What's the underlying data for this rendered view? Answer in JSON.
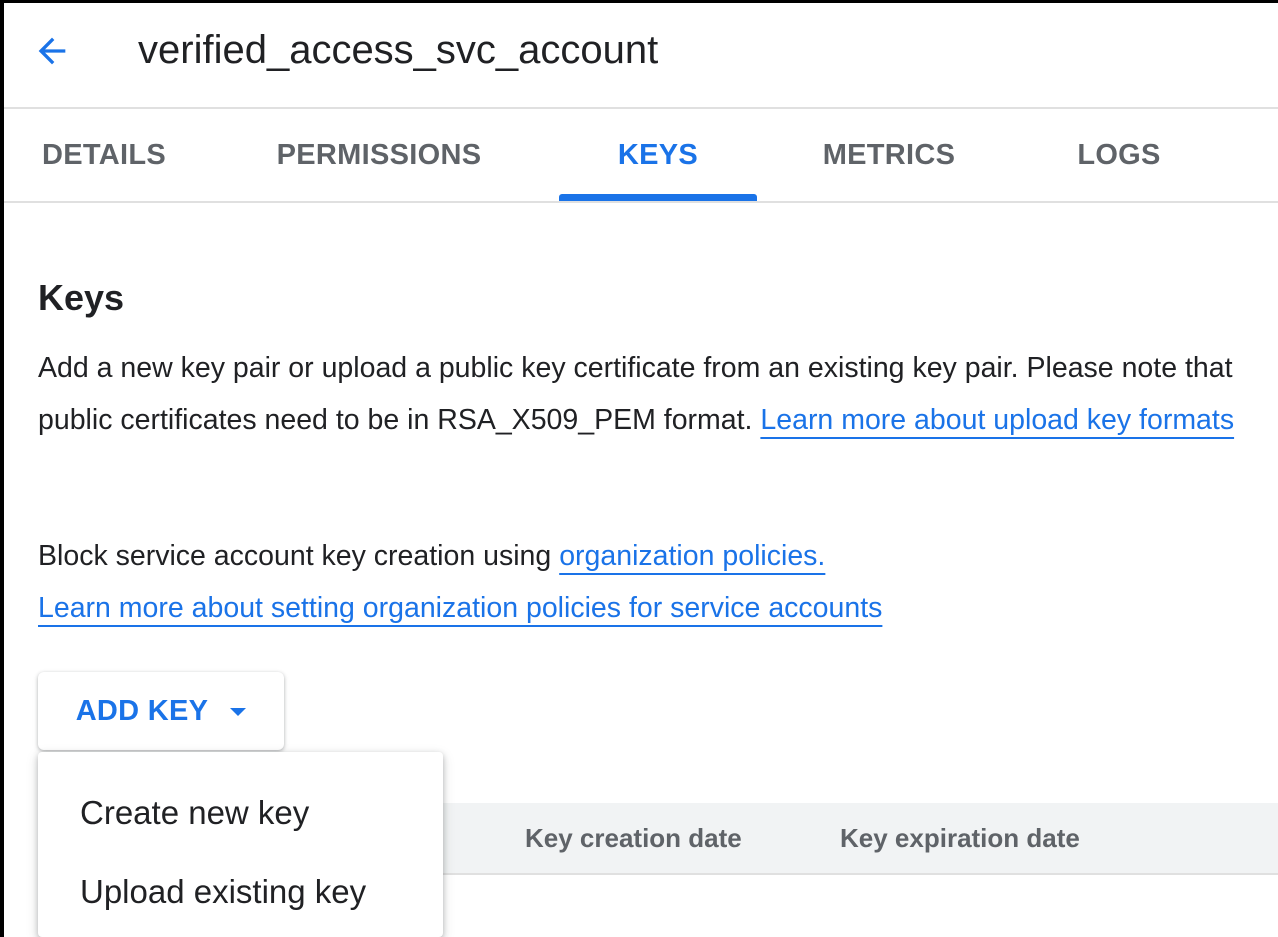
{
  "header": {
    "back_icon": "arrow-back-icon",
    "title": "verified_access_svc_account"
  },
  "tabs": [
    {
      "label": "DETAILS",
      "active": false
    },
    {
      "label": "PERMISSIONS",
      "active": false
    },
    {
      "label": "KEYS",
      "active": true
    },
    {
      "label": "METRICS",
      "active": false
    },
    {
      "label": "LOGS",
      "active": false
    }
  ],
  "keys_section": {
    "title": "Keys",
    "description": "Add a new key pair or upload a public key certificate from an existing key pair. Please note that public certificates need to be in RSA_X509_PEM format.",
    "learn_more_link": "Learn more about upload key formats",
    "block_text": "Block service account key creation using",
    "org_policies_link": "organization policies.",
    "org_learn_more_link": "Learn more about setting organization policies for service accounts"
  },
  "add_key_button": {
    "label": "ADD KEY",
    "icon": "arrow-drop-down-icon"
  },
  "add_key_menu": {
    "items": [
      "Create new key",
      "Upload existing key"
    ]
  },
  "keys_table": {
    "columns": [
      "Key creation date",
      "Key expiration date"
    ]
  },
  "colors": {
    "accent": "#1a73e8",
    "text_primary": "#202124",
    "text_secondary": "#5f6368",
    "divider": "#e0e0e0",
    "table_header_bg": "#f1f3f4"
  }
}
